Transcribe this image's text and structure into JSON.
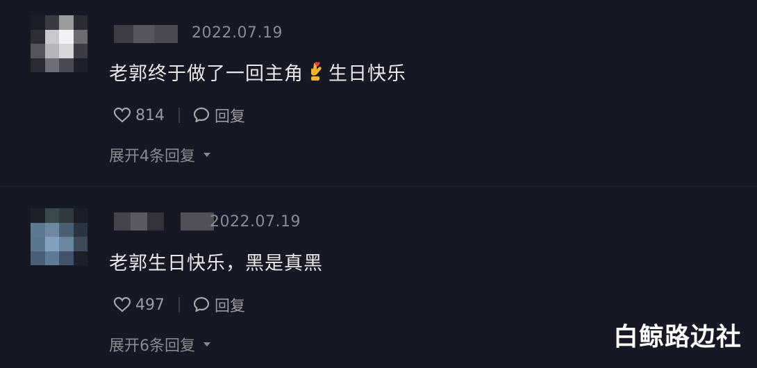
{
  "comments": [
    {
      "date": "2022.07.19",
      "text_before": "老郭终于做了一回主角",
      "text_after": "生日快乐",
      "emoji": "crossed-fingers-heart-icon",
      "likes": "814",
      "reply_label": "回复",
      "expand_label": "展开4条回复"
    },
    {
      "date": "2022.07.19",
      "text": "老郭生日快乐，黑是真黑",
      "likes": "497",
      "reply_label": "回复",
      "expand_label": "展开6条回复"
    }
  ],
  "watermark": "白鲸路边社",
  "colors": {
    "background": "#161823",
    "text": "#e8e8ea",
    "muted": "#8a8b91"
  }
}
